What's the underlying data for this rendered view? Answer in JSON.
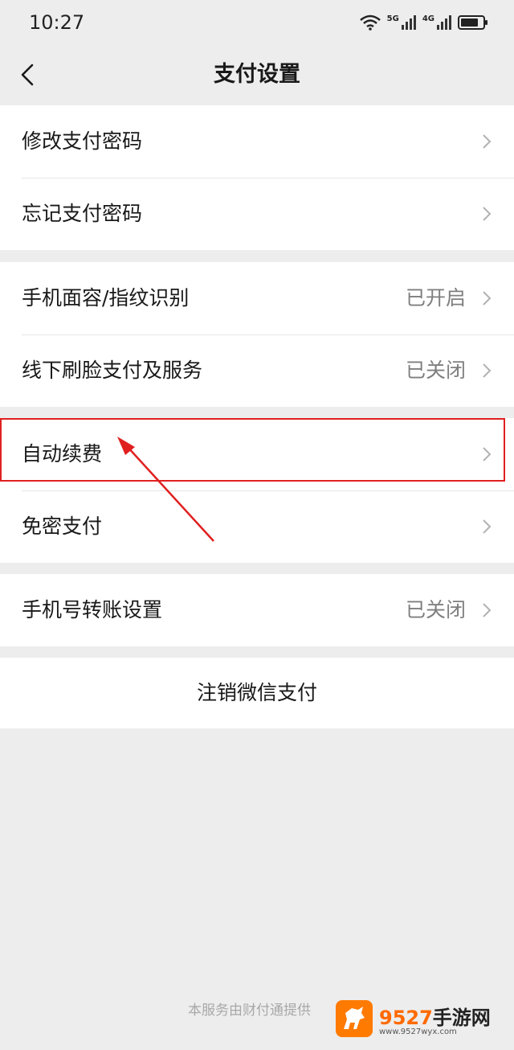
{
  "status_bar": {
    "time": "10:27",
    "wifi_icon": "wifi-icon",
    "network_5g": "5G",
    "network_4g": "4G",
    "battery_level": 0.7
  },
  "nav": {
    "back_icon": "chevron-left-icon",
    "title": "支付设置"
  },
  "sections": [
    {
      "rows": [
        {
          "label": "修改支付密码",
          "value": ""
        },
        {
          "label": "忘记支付密码",
          "value": ""
        }
      ]
    },
    {
      "rows": [
        {
          "label": "手机面容/指纹识别",
          "value": "已开启"
        },
        {
          "label": "线下刷脸支付及服务",
          "value": "已关闭"
        }
      ]
    },
    {
      "rows": [
        {
          "label": "自动续费",
          "value": ""
        },
        {
          "label": "免密支付",
          "value": ""
        }
      ]
    },
    {
      "rows": [
        {
          "label": "手机号转账设置",
          "value": "已关闭"
        }
      ]
    }
  ],
  "cancel_label": "注销微信支付",
  "footer": "本服务由财付通提供",
  "annotation_color": "#e02020",
  "watermark": {
    "brand": "9527",
    "brand_cn": "手游网",
    "url": "www.9527wyx.com"
  }
}
